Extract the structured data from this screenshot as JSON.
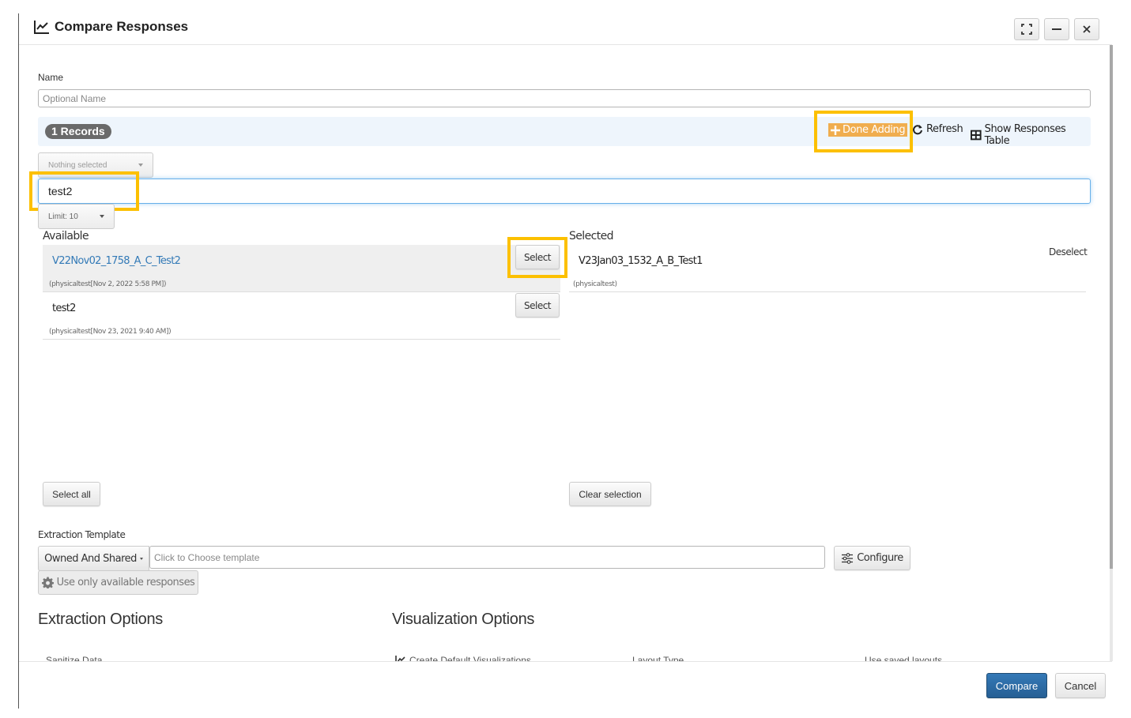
{
  "window": {
    "title": "Compare Responses",
    "title_icon": "line-chart-icon",
    "controls": [
      {
        "name": "maximize-button",
        "icon": "expand-icon"
      },
      {
        "name": "minimize-button",
        "icon": "minus-icon"
      },
      {
        "name": "close-button",
        "icon": "close-icon"
      }
    ]
  },
  "name_field": {
    "label": "Name",
    "placeholder": "Optional Name",
    "value": ""
  },
  "records_bar": {
    "badge": "1 Records",
    "actions": {
      "done_adding": "Done Adding",
      "refresh": "Refresh",
      "show_table": "Show Responses Table"
    }
  },
  "filters": {
    "owner_dropdown": "Nothing selected",
    "search_value": "test2",
    "limit_dropdown": "Limit: 10"
  },
  "available": {
    "heading": "Available",
    "items": [
      {
        "title": "V22Nov02_1758_A_C_Test2",
        "subtitle": "(physicaltest[Nov 2, 2022 5:58 PM])",
        "action": "Select",
        "active": true
      },
      {
        "title": "test2",
        "subtitle": "(physicaltest[Nov 23, 2021 9:40 AM])",
        "action": "Select",
        "active": false
      }
    ],
    "select_all": "Select all"
  },
  "selected": {
    "heading": "Selected",
    "deselect": "Deselect",
    "items": [
      {
        "title": "V23Jan03_1532_A_B_Test1",
        "subtitle": "(physicaltest)"
      }
    ],
    "clear_selection": "Clear selection"
  },
  "extraction_template": {
    "label": "Extraction Template",
    "scope_dropdown": "Owned And Shared",
    "template_placeholder": "Click to Choose template",
    "configure": "Configure",
    "use_available": "Use only available responses"
  },
  "extraction_options": {
    "heading": "Extraction Options",
    "first_option": "Sanitize Data"
  },
  "visualization_options": {
    "heading": "Visualization Options",
    "create_default": "Create Default Visualizations",
    "layout_type": "Layout Type",
    "use_saved": "Use saved layouts"
  },
  "footer": {
    "compare": "Compare",
    "cancel": "Cancel"
  },
  "colors": {
    "accent_primary": "#286090",
    "done_adding_bg": "#f0ad4e",
    "highlight_box": "#fcc000",
    "link": "#337ab7",
    "records_bar_bg": "#eef5fc"
  }
}
